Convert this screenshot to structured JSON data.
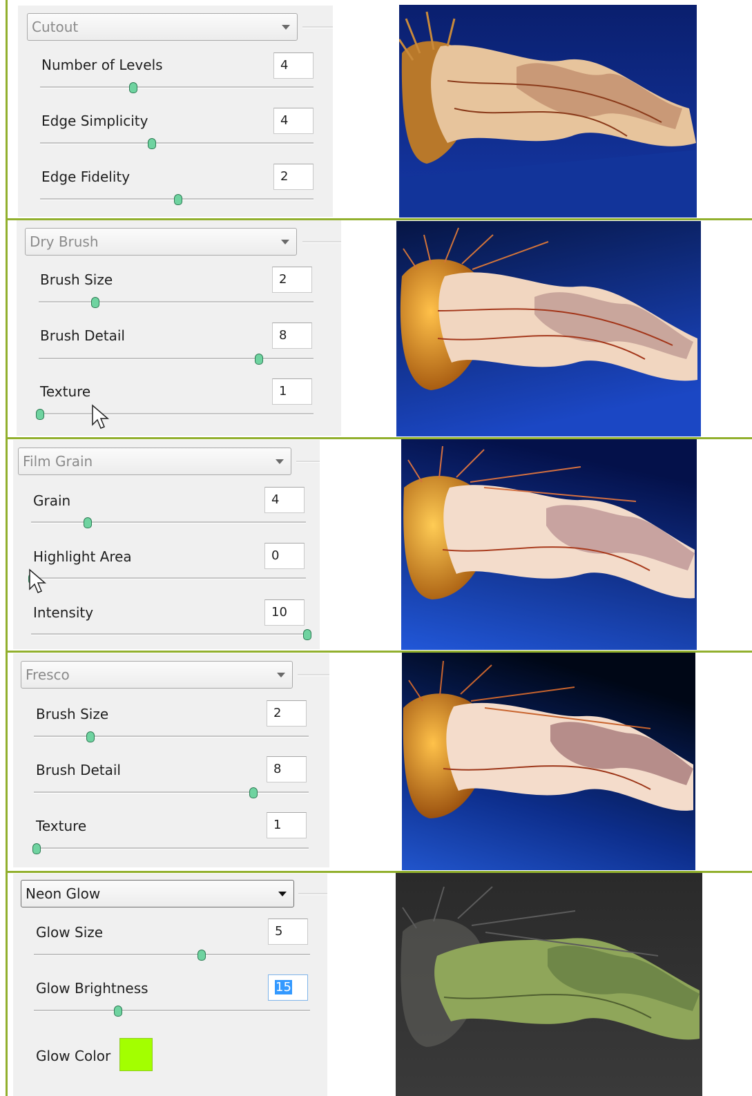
{
  "colors": {
    "border_line": "#92b02e",
    "panel_bg": "#f0f0f0",
    "slider_thumb": "#6fd3a0",
    "glow_color": "#a3ff00"
  },
  "filters": [
    {
      "name": "Cutout",
      "params": [
        {
          "label": "Number of Levels",
          "value": "4",
          "level": 0.34
        },
        {
          "label": "Edge Simplicity",
          "value": "4",
          "level": 0.41
        },
        {
          "label": "Edge Fidelity",
          "value": "2",
          "level": 0.51
        }
      ],
      "preview": "jellyfish-cutout"
    },
    {
      "name": "Dry Brush",
      "params": [
        {
          "label": "Brush Size",
          "value": "2",
          "level": 0.2
        },
        {
          "label": "Brush Detail",
          "value": "8",
          "level": 0.8
        },
        {
          "label": "Texture",
          "value": "1",
          "level": 0.0
        }
      ],
      "preview": "jellyfish-dry-brush"
    },
    {
      "name": "Film Grain",
      "params": [
        {
          "label": "Grain",
          "value": "4",
          "level": 0.2
        },
        {
          "label": "Highlight Area",
          "value": "0",
          "level": 0.0
        },
        {
          "label": "Intensity",
          "value": "10",
          "level": 1.0
        }
      ],
      "preview": "jellyfish-film-grain"
    },
    {
      "name": "Fresco",
      "params": [
        {
          "label": "Brush Size",
          "value": "2",
          "level": 0.2
        },
        {
          "label": "Brush Detail",
          "value": "8",
          "level": 0.8
        },
        {
          "label": "Texture",
          "value": "1",
          "level": 0.0
        }
      ],
      "preview": "jellyfish-fresco"
    },
    {
      "name": "Neon Glow",
      "params": [
        {
          "label": "Glow Size",
          "value": "5",
          "level": 0.6
        },
        {
          "label": "Glow Brightness",
          "value": "15",
          "level": 0.3
        }
      ],
      "extra_label": "Glow Color",
      "preview": "jellyfish-neon-glow"
    }
  ]
}
